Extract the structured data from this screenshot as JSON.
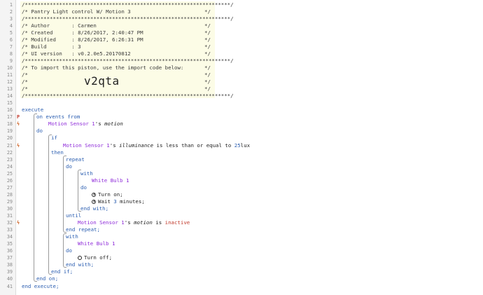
{
  "header_comment": {
    "border": "/******************************************************************/",
    "title": "/* Pantry Light control W/ Motion 3",
    "author": "/* Author       : Carmen",
    "created": "/* Created      : 8/26/2017, 2:40:47 PM",
    "modified": "/* Modified     : 8/26/2017, 6:26:31 PM",
    "build": "/* Build        : 3",
    "ui_version": "/* UI version   : v0.2.0e5.20170812",
    "import_note": "/* To import this piston, use the import code below:",
    "blank": "/*",
    "end_mark": "*/",
    "import_code": "v2qta"
  },
  "code": {
    "execute": "execute",
    "on_events_from": "on events from",
    "motion_sensor": "Motion Sensor 1",
    "possessive": "'s",
    "motion": "motion",
    "do": "do",
    "if": "if",
    "illuminance": "illuminance",
    "less_equal": "is less than or equal to",
    "lux_value": "25",
    "lux_unit": "lux",
    "then": "then",
    "repeat": "repeat",
    "with": "with",
    "white_bulb": "White Bulb 1",
    "turn_on": "Turn on;",
    "wait_prefix": "Wait ",
    "wait_value": "3",
    "wait_suffix": " minutes;",
    "end_with": "end with;",
    "until": "until",
    "is": "is",
    "inactive": "inactive",
    "end_repeat": "end repeat;",
    "turn_off": "Turn off;",
    "end_if": "end if;",
    "end_on": "end on;",
    "end_execute": "end execute;"
  },
  "markers": {
    "p": "P",
    "s": "ϟ"
  },
  "line_numbers": [
    "1",
    "2",
    "3",
    "4",
    "5",
    "6",
    "7",
    "8",
    "9",
    "10",
    "11",
    "12",
    "13",
    "14",
    "15",
    "16",
    "17",
    "18",
    "19",
    "20",
    "21",
    "22",
    "23",
    "24",
    "25",
    "26",
    "27",
    "28",
    "29",
    "30",
    "31",
    "32",
    "33",
    "34",
    "35",
    "36",
    "37",
    "38",
    "39",
    "40",
    "41"
  ]
}
